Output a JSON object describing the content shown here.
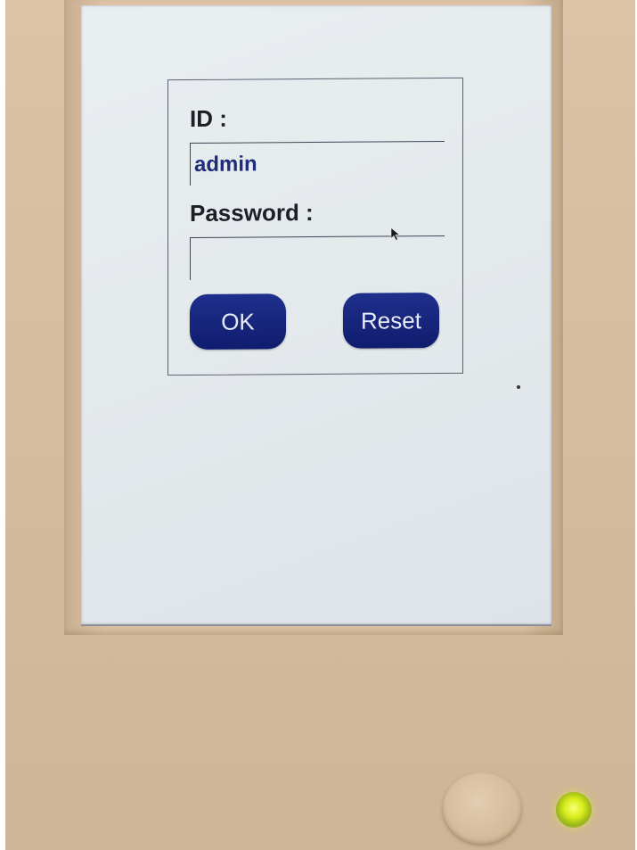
{
  "login": {
    "id_label": "ID :",
    "id_value": "admin",
    "password_label": "Password :",
    "password_value": "",
    "ok_label": "OK",
    "reset_label": "Reset"
  },
  "colors": {
    "button": "#14237a",
    "field_text": "#1f2c7a",
    "led": "#d9ee1a"
  },
  "icons": {
    "cursor": "cursor-icon",
    "led": "led-indicator",
    "home": "home-button"
  }
}
